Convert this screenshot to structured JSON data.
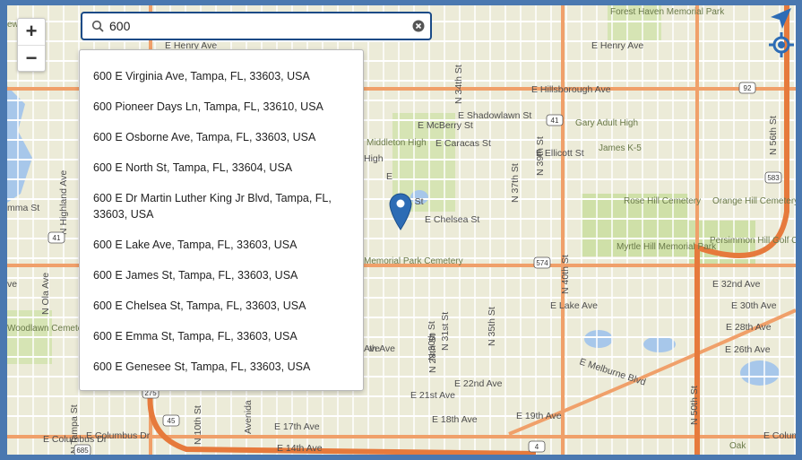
{
  "search": {
    "value": "600",
    "suggestions": [
      "600 E Virginia Ave, Tampa, FL, 33603, USA",
      "600 Pioneer Days Ln, Tampa, FL, 33610, USA",
      "600 E Osborne Ave, Tampa, FL, 33603, USA",
      "600 E North St, Tampa, FL, 33604, USA",
      "600 E Dr Martin Luther King Jr Blvd, Tampa, FL, 33603, USA",
      "600 E Lake Ave, Tampa, FL, 33603, USA",
      "600 E James St, Tampa, FL, 33603, USA",
      "600 E Chelsea St, Tampa, FL, 33603, USA",
      "600 E Emma St, Tampa, FL, 33603, USA",
      "600 E Genesee St, Tampa, FL, 33603, USA"
    ]
  },
  "zoom": {
    "in_label": "+",
    "out_label": "−"
  },
  "map": {
    "streets": [
      "E Hillsborough Ave",
      "E Henry Ave",
      "E McBerry St",
      "E Shadowlawn St",
      "E Caracas St",
      "E Ellicott St",
      "E Chelsea St",
      "E 32nd Ave",
      "E 30th Ave",
      "E 28th Ave",
      "E 26th Ave",
      "E Melburne Blvd",
      "E 22nd Ave",
      "E 21st Ave",
      "E 19th Ave",
      "E 18th Ave",
      "E 17th Ave",
      "E 14th Ave",
      "E Columbus Dr",
      "E Colum",
      "E Lake Ave",
      "N 40th St",
      "N 39th St",
      "N 37th St",
      "N 35th St",
      "N 34th St",
      "N 28th St",
      "N 30th St",
      "N 31st St",
      "N 50th St",
      "N 56th St",
      "N Highland Ave",
      "N Ola Ave",
      "N Tampa St",
      "N 10th St",
      "Avenida",
      "E Henry Ave",
      "High",
      "Ave",
      "E",
      "mma St",
      "ve",
      "E Columbus Dr",
      "ga St",
      "th Ave"
    ],
    "places": [
      "Forest Haven Memorial Park",
      "Gary Adult High",
      "James K-5",
      "Rose Hill Cemetery",
      "Orange Hill Cemetery",
      "Myrtle Hill Memorial Park",
      "Persimmon Hill Golf Course",
      "Woodlawn Cemetery",
      "Memorial Park Cemetery",
      "Middleton High",
      "Oak",
      "ew"
    ],
    "shields": [
      "92",
      "41",
      "583",
      "574",
      "41",
      "275",
      "45",
      "685",
      "4"
    ]
  },
  "colors": {
    "search_border": "#1a4a86",
    "pin": "#2d6cb5",
    "arterial": "#f0a06a",
    "water": "#a7c7ea",
    "park": "#cfe0a8"
  },
  "icons": {
    "search": "search-icon",
    "clear": "clear-icon",
    "navigation": "navigation-arrow-icon",
    "locate": "locate-icon",
    "pin": "map-pin-icon"
  }
}
